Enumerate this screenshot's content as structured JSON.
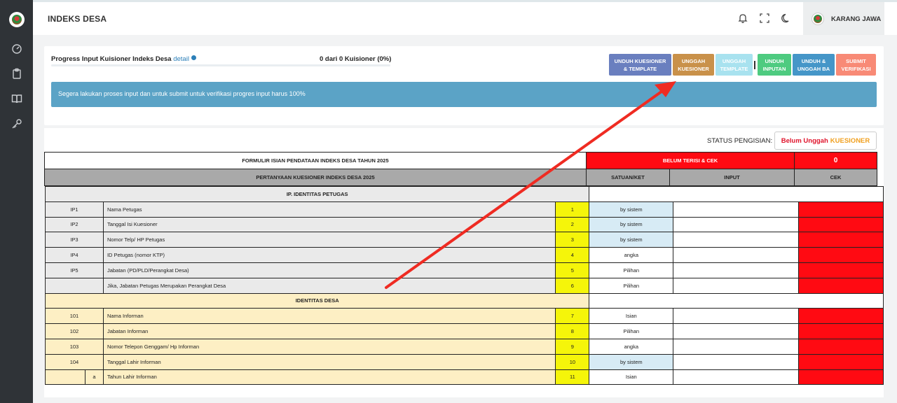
{
  "sidebar": {
    "icons": [
      "dashboard-icon",
      "clipboard-icon",
      "book-icon",
      "key-icon"
    ]
  },
  "header": {
    "title": "INDEKS DESA",
    "user_name": "KARANG JAWA",
    "icons": [
      "bell-icon",
      "fullscreen-icon",
      "moon-icon"
    ]
  },
  "progress": {
    "label": "Progress Input Kuisioner Indeks Desa",
    "detail_link": "detail",
    "count_text": "0 dari 0 Kuisioner (0%)",
    "percent": 0
  },
  "actions": [
    {
      "l1": "UNDUH KUESIONER",
      "l2": "& TEMPLATE",
      "color": "#6a7fbf"
    },
    {
      "l1": "UNGGAH",
      "l2": "KUESIONER",
      "color": "#c9914a"
    },
    {
      "l1": "UNGGAH",
      "l2": "TEMPLATE",
      "color": "#a8e2ef"
    },
    {
      "l1": "UNDUH",
      "l2": "INPUTAN",
      "color": "#4ecb80"
    },
    {
      "l1": "UNDUH &",
      "l2": "UNGGAH BA",
      "color": "#4596c8"
    },
    {
      "l1": "SUBMIT",
      "l2": "VERIFIKASI",
      "color": "#f88a76"
    }
  ],
  "alert": {
    "text": "Segera lakukan proses input dan untuk submit untuk verifikasi progres input harus 100%",
    "color": "#5ba3c6"
  },
  "status": {
    "label": "STATUS PENGISIAN:",
    "part1": "Belum Unggah",
    "part2": "KUESIONER"
  },
  "form": {
    "title": "FORMULIR ISIAN PENDATAAN INDEKS DESA TAHUN 2025",
    "status_cell": "BELUM TERISI & CEK",
    "count": "0",
    "questions_header": "PERTANYAAN KUESIONER INDEKS DESA 2025",
    "col_satuan": "SATUAN/KET",
    "col_input": "INPUT",
    "col_cek": "CEK"
  },
  "sections": {
    "petugas": "IP. IDENTITAS PETUGAS",
    "desa": "IDENTITAS DESA"
  },
  "rows_petugas": [
    {
      "code": "IP1",
      "question": "Nama Petugas",
      "no": "1",
      "satuan": "by sistem",
      "sys": true
    },
    {
      "code": "IP2",
      "question": "Tanggal Isi Kuesioner",
      "no": "2",
      "satuan": "by sistem",
      "sys": true
    },
    {
      "code": "IP3",
      "question": "Nomor Telp/ HP Petugas",
      "no": "3",
      "satuan": "by sistem",
      "sys": true
    },
    {
      "code": "IP4",
      "question": "ID Petugas (nomor KTP)",
      "no": "4",
      "satuan": "angka",
      "sys": false
    },
    {
      "code": "IP5",
      "question": "Jabatan (PD/PLD/Perangkat Desa)",
      "no": "5",
      "satuan": "Pilihan",
      "sys": false
    },
    {
      "code": "",
      "question": "Jika, Jabatan Petugas Merupakan Perangkat Desa",
      "no": "6",
      "satuan": "Pilihan",
      "sys": false
    }
  ],
  "rows_desa": [
    {
      "code": "101",
      "sub": "",
      "question": "Nama Informan",
      "no": "7",
      "satuan": "Isian",
      "sys": false
    },
    {
      "code": "102",
      "sub": "",
      "question": "Jabatan Informan",
      "no": "8",
      "satuan": "Pilihan",
      "sys": false
    },
    {
      "code": "103",
      "sub": "",
      "question": "Nomor Telepon Genggam/ Hp Informan",
      "no": "9",
      "satuan": "angka",
      "sys": false
    },
    {
      "code": "104",
      "sub": "",
      "question": "Tanggal Lahir Informan",
      "no": "10",
      "satuan": "by sistem",
      "sys": true
    },
    {
      "code": "",
      "sub": "a",
      "question": "Tahun Lahir Informan",
      "no": "11",
      "satuan": "Isian",
      "sys": false
    }
  ]
}
